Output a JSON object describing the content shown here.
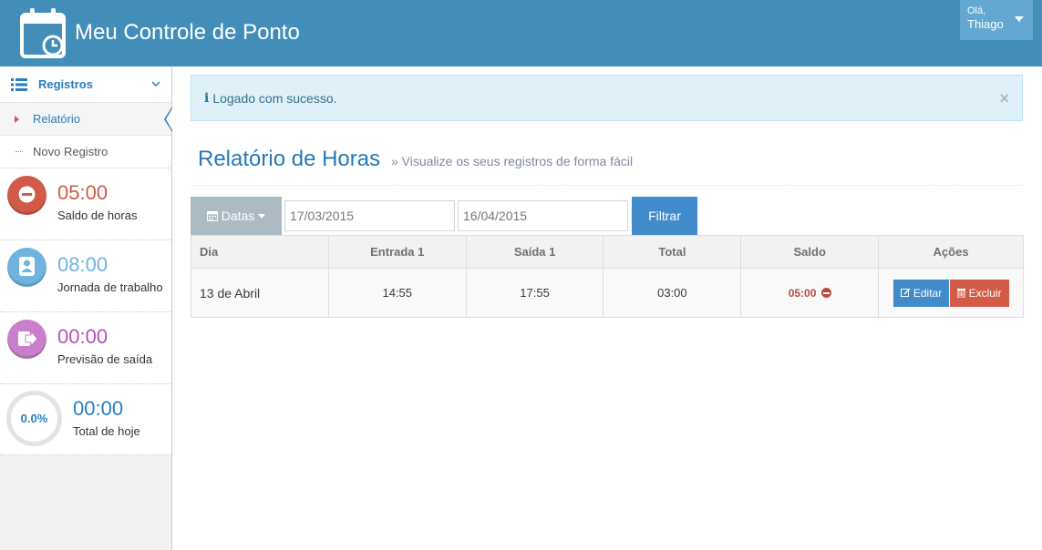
{
  "app": {
    "title": "Meu Controle de Ponto"
  },
  "user": {
    "greeting": "Olá,",
    "name": "Thiago"
  },
  "sidebar": {
    "menu_label": "Registros",
    "items": [
      {
        "label": "Relatório",
        "active": true
      },
      {
        "label": "Novo Registro",
        "active": false
      }
    ],
    "stats": [
      {
        "value": "05:00",
        "label": "Saldo de horas",
        "icon": "minus-circle-icon",
        "color": "#d15b47"
      },
      {
        "value": "08:00",
        "label": "Jornada de trabalho",
        "icon": "user-icon",
        "color": "#6fb3e0"
      },
      {
        "value": "00:00",
        "label": "Previsão de saída",
        "icon": "sign-out-icon",
        "color": "#c97fc9"
      },
      {
        "value": "00:00",
        "label": "Total de hoje",
        "percent": "0.0%",
        "color": "#2b7dbc"
      }
    ]
  },
  "alert": {
    "message": "Logado com sucesso.",
    "close": "×"
  },
  "page": {
    "title": "Relatório de Horas",
    "subtitle": "» Visualize os seus registros de forma fácil"
  },
  "filter": {
    "datas_label": "Datas",
    "date_from": "17/03/2015",
    "date_to": "16/04/2015",
    "filter_label": "Filtrar"
  },
  "table": {
    "headers": [
      "Dia",
      "Entrada 1",
      "Saída 1",
      "Total",
      "Saldo",
      "Ações"
    ],
    "rows": [
      {
        "dia": "13 de Abril",
        "entrada": "14:55",
        "saida": "17:55",
        "total": "03:00",
        "saldo": "05:00",
        "edit_label": "Editar",
        "delete_label": "Excluir"
      }
    ]
  },
  "colors": {
    "navbar": "#438eb9",
    "accent": "#2b7dbc",
    "danger": "#d15b47"
  }
}
